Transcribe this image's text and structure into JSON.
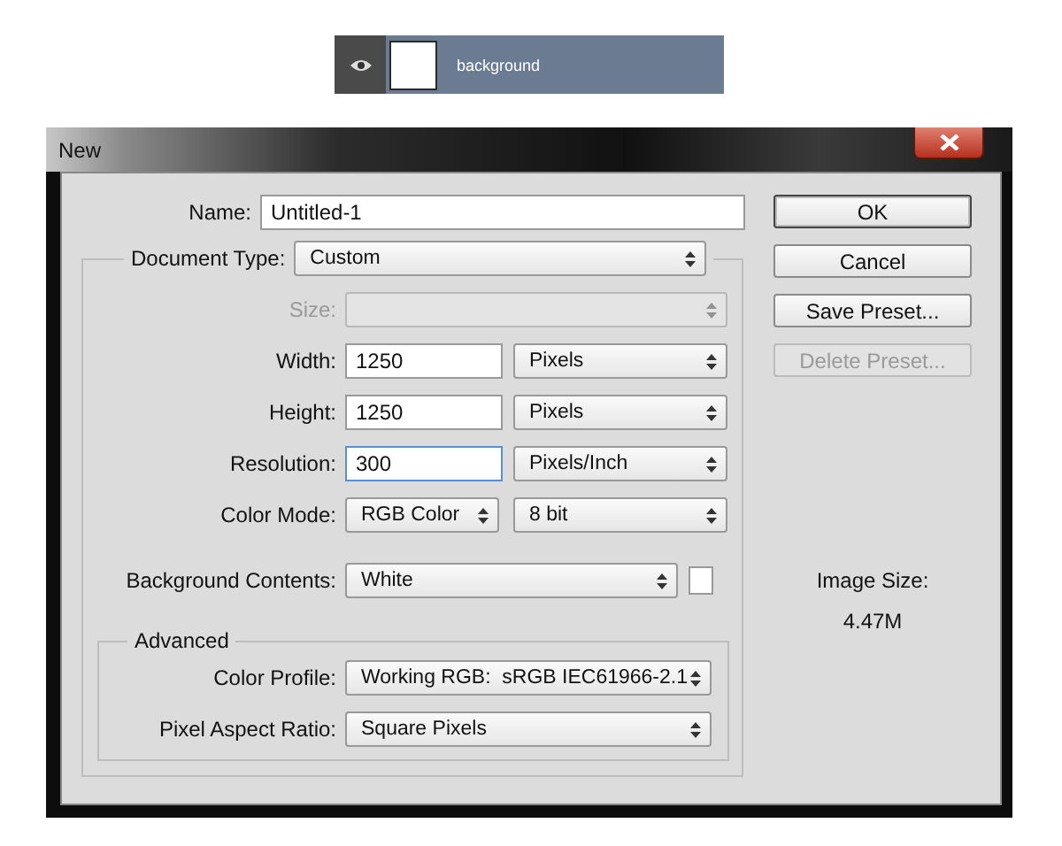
{
  "layer": {
    "name": "background",
    "visible": true
  },
  "window": {
    "title": "New"
  },
  "name_field": {
    "label": "Name:",
    "value": "Untitled-1",
    "focused": false
  },
  "document_type": {
    "label": "Document Type:",
    "value": "Custom"
  },
  "rows": [
    {
      "label": "Size:",
      "disabled": true,
      "fields": [
        {
          "kind": "select"
        }
      ]
    },
    {
      "label": "Width:",
      "disabled": false,
      "fields": [
        {
          "kind": "input",
          "value": "1250",
          "focused": false
        },
        {
          "kind": "select",
          "value": "Pixels"
        }
      ]
    },
    {
      "label": "Height:",
      "disabled": false,
      "fields": [
        {
          "kind": "input",
          "value": "1250",
          "focused": false
        },
        {
          "kind": "select",
          "value": "Pixels"
        }
      ]
    },
    {
      "label": "Resolution:",
      "disabled": false,
      "fields": [
        {
          "kind": "input",
          "value": "300",
          "focused": true
        },
        {
          "kind": "select",
          "value": "Pixels/Inch"
        }
      ]
    },
    {
      "label": "Color Mode:",
      "disabled": false,
      "fields": [
        {
          "kind": "select",
          "value": "RGB Color"
        },
        {
          "kind": "select",
          "value": "8 bit"
        }
      ]
    },
    {
      "label": "Background Contents:",
      "disabled": false,
      "fields": [
        {
          "kind": "select",
          "value": "White"
        },
        {
          "kind": "swatch",
          "color": "#ffffff"
        }
      ]
    }
  ],
  "advanced": {
    "title": "Advanced",
    "rows": [
      {
        "label": "Color Profile:",
        "disabled": false,
        "fields": [
          {
            "kind": "select",
            "value": "Working RGB:  sRGB IEC61966-2.1"
          }
        ]
      },
      {
        "label": "Pixel Aspect Ratio:",
        "disabled": false,
        "fields": [
          {
            "kind": "select",
            "value": "Square Pixels"
          }
        ]
      }
    ]
  },
  "buttons": [
    {
      "label": "OK",
      "default": true,
      "disabled": false
    },
    {
      "label": "Cancel",
      "default": false,
      "disabled": false
    },
    {
      "label": "Save Preset...",
      "default": false,
      "disabled": false
    },
    {
      "label": "Delete Preset...",
      "default": false,
      "disabled": true
    }
  ],
  "image_size": {
    "label": "Image Size:",
    "value": "4.47M"
  }
}
